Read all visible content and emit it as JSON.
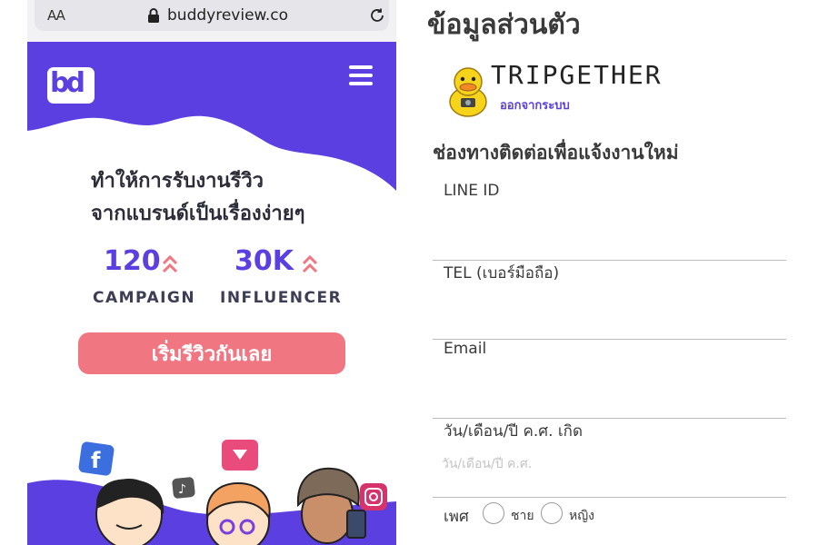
{
  "browser": {
    "aa_label": "AA",
    "url": "buddyreview.co"
  },
  "site": {
    "logo_text": "bd",
    "headline_line1": "ทำให้การรับงานรีวิว",
    "headline_line2": "จากแบรนด์เป็นเรื่องง่ายๆ",
    "stats": [
      {
        "value": "120",
        "label": "CAMPAIGN"
      },
      {
        "value": "30K",
        "label": "INFLUENCER"
      }
    ],
    "cta_label": "เริ่มรีวิวกันเลย",
    "colors": {
      "brand_purple": "#5b3fe0",
      "cta_pink": "#f07681"
    },
    "social_icons": [
      "facebook-icon",
      "tiktok-icon",
      "youtube-icon",
      "instagram-icon"
    ]
  },
  "profile": {
    "page_title": "ข้อมูลส่วนตัว",
    "username": "TRIPGETHER",
    "logout_label": "ออกจากระบบ",
    "section_title": "ช่องทางติดต่อเพื่อแจ้งงานใหม่",
    "fields": [
      {
        "label": "LINE ID",
        "value": "",
        "placeholder": ""
      },
      {
        "label": "TEL (เบอร์มือถือ)",
        "value": "",
        "placeholder": ""
      },
      {
        "label": "Email",
        "value": "",
        "placeholder": ""
      },
      {
        "label": "วัน/เดือน/ปี ค.ศ. เกิด",
        "value": "",
        "placeholder": "วัน/เดือน/ปี ค.ศ."
      }
    ],
    "gender": {
      "label": "เพศ",
      "options": [
        "ชาย",
        "หญิง"
      ]
    }
  }
}
